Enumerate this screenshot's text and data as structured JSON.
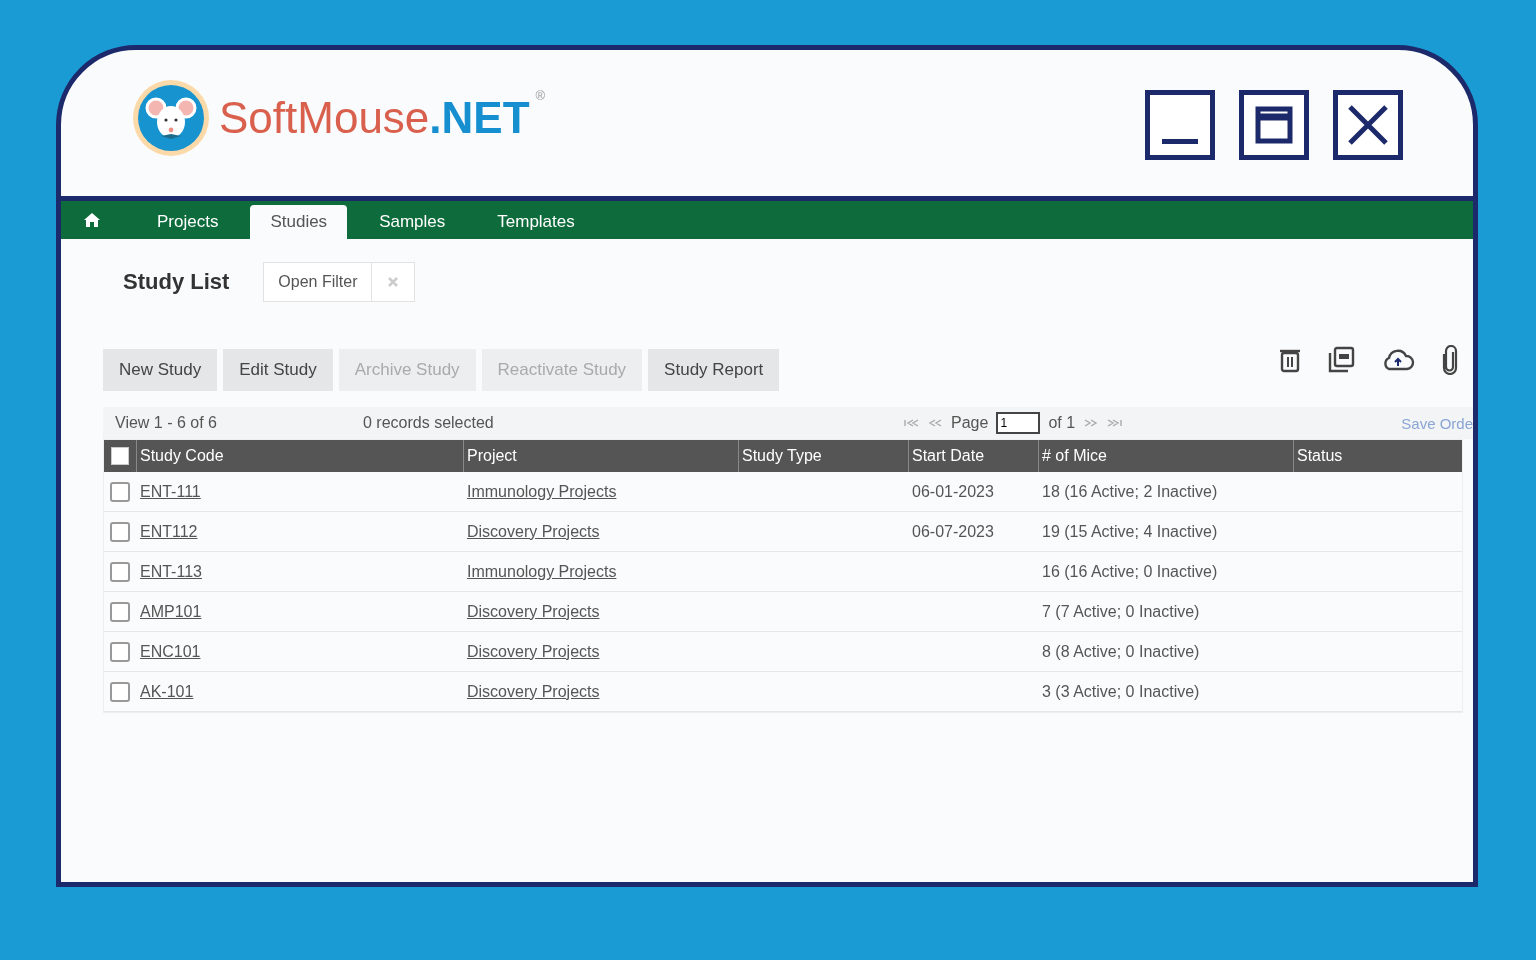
{
  "logo": {
    "name": "SoftMouse",
    "suffix": ".NET",
    "mark": "®"
  },
  "tabs": [
    {
      "label": "Projects",
      "selected": false
    },
    {
      "label": "Studies",
      "selected": true
    },
    {
      "label": "Samples",
      "selected": false
    },
    {
      "label": "Templates",
      "selected": false
    }
  ],
  "heading": "Study List",
  "filter": {
    "label": "Open Filter"
  },
  "actions": [
    {
      "label": "New Study",
      "disabled": false
    },
    {
      "label": "Edit Study",
      "disabled": false
    },
    {
      "label": "Archive Study",
      "disabled": true
    },
    {
      "label": "Reactivate Study",
      "disabled": true
    },
    {
      "label": "Study Report",
      "disabled": false
    }
  ],
  "pager": {
    "view": "View 1 - 6 of 6",
    "selected_count": "0 records selected",
    "page_label": "Page",
    "page_value": "1",
    "of": "of 1",
    "save": "Save Orde"
  },
  "table": {
    "select_all": {
      "checked": false
    },
    "columns": [
      "Study Code",
      "Project",
      "Study Type",
      "Start Date",
      "# of Mice",
      "Status"
    ],
    "rows": [
      {
        "checked": false,
        "cells": [
          "ENT-111",
          "Immunology Projects",
          "",
          "06-01-2023",
          "18 (16 Active; 2 Inactive)",
          ""
        ]
      },
      {
        "checked": false,
        "cells": [
          "ENT112",
          "Discovery Projects",
          "",
          "06-07-2023",
          "19 (15 Active; 4 Inactive)",
          ""
        ]
      },
      {
        "checked": false,
        "cells": [
          "ENT-113",
          "Immunology Projects",
          "",
          "",
          "16 (16 Active; 0 Inactive)",
          ""
        ]
      },
      {
        "checked": false,
        "cells": [
          "AMP101",
          "Discovery Projects",
          "",
          "",
          "7 (7 Active; 0 Inactive)",
          ""
        ]
      },
      {
        "checked": false,
        "cells": [
          "ENC101",
          "Discovery Projects",
          "",
          "",
          "8 (8 Active; 0 Inactive)",
          ""
        ]
      },
      {
        "checked": false,
        "cells": [
          "AK-101",
          "Discovery Projects",
          "",
          "",
          "3 (3 Active; 0 Inactive)",
          ""
        ]
      }
    ]
  }
}
